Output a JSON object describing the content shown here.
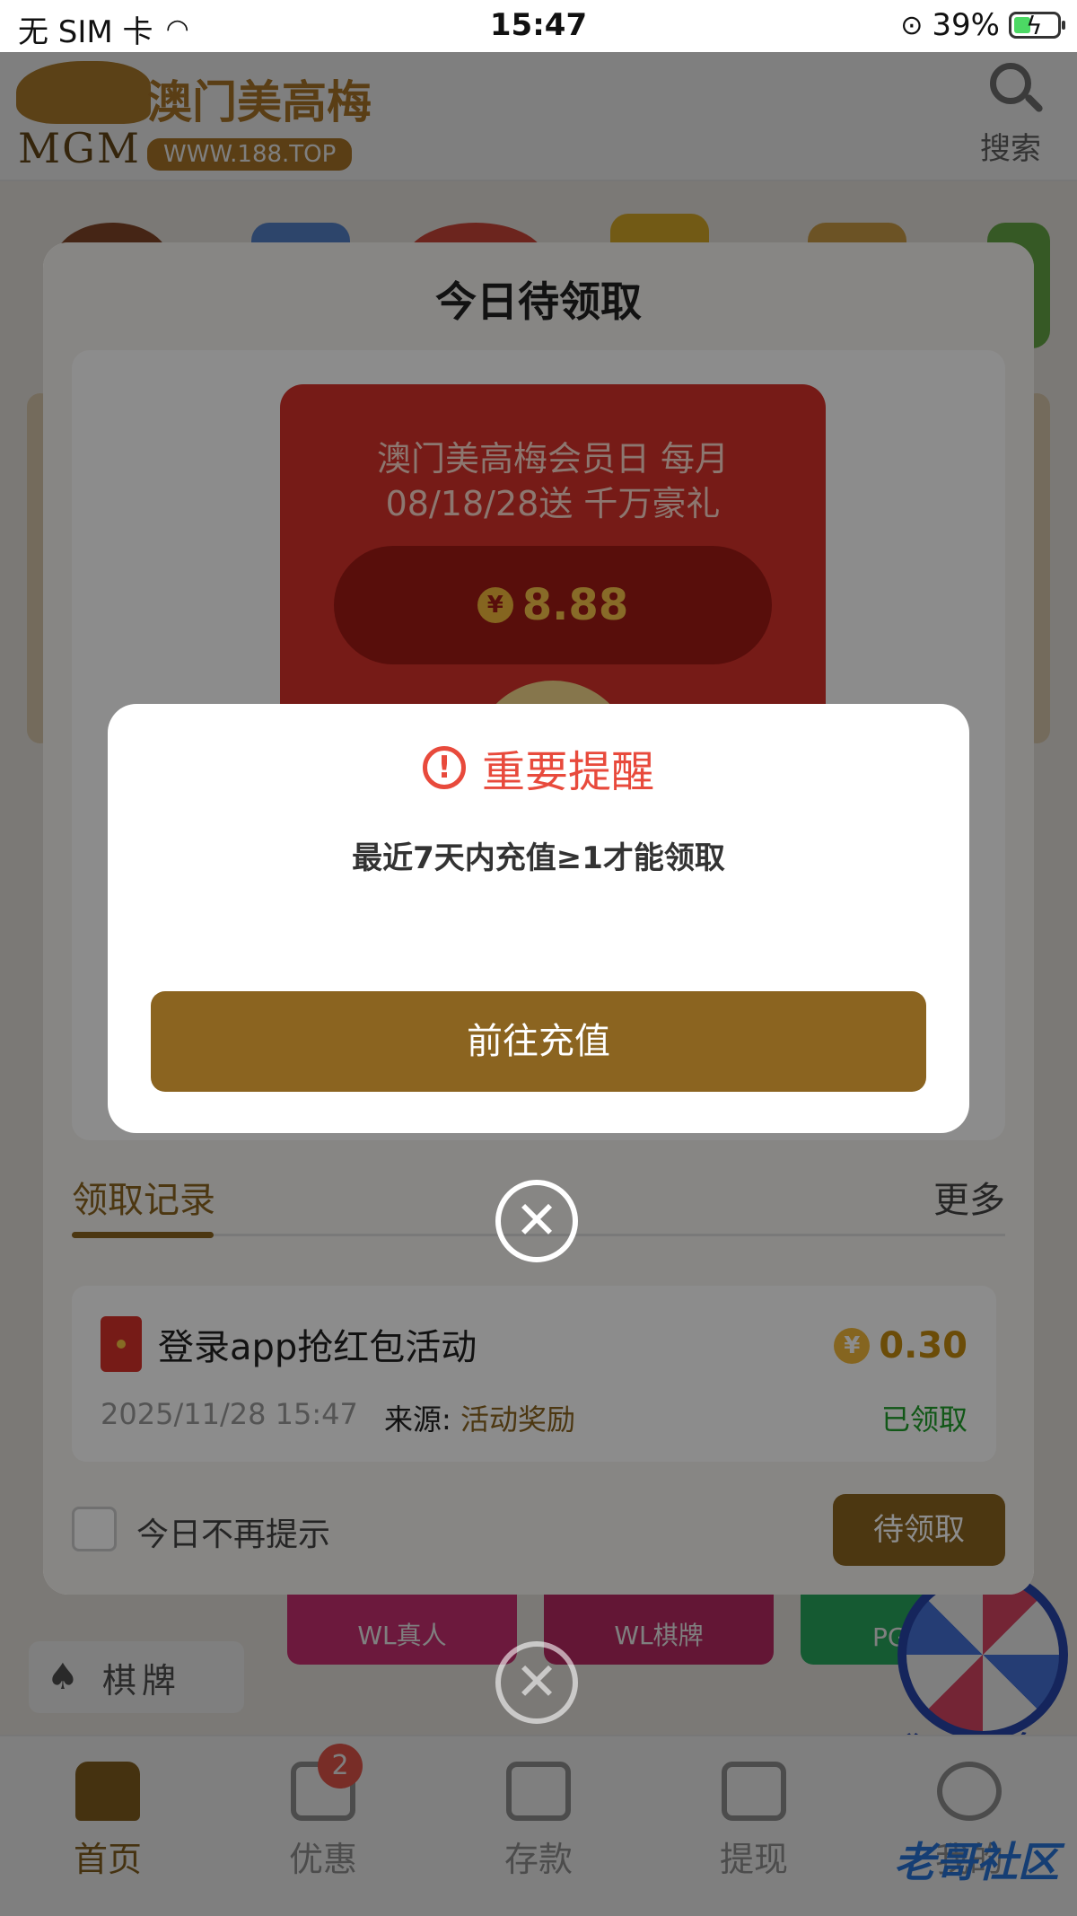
{
  "status_bar": {
    "carrier": "无 SIM 卡",
    "time": "15:47",
    "battery_percent": "39%"
  },
  "header": {
    "brand_cn": "澳门美高梅",
    "brand_en": "MGM",
    "site_url": "WWW.188.TOP",
    "search_label": "搜索"
  },
  "page": {
    "category_label": "棋牌",
    "tiles": [
      "WL真人",
      "WL棋牌",
      "PG"
    ],
    "wheel_label": "狂欢转盘"
  },
  "claim_panel": {
    "title": "今日待领取",
    "red_packet": {
      "line1": "澳门美高梅会员日 每月",
      "line2": "08/18/28送 千万豪礼",
      "amount": "8.88",
      "currency_symbol": "¥"
    },
    "records_tab": "领取记录",
    "more": "更多",
    "record": {
      "title": "登录app抢红包活动",
      "amount": "0.30",
      "currency_symbol": "¥",
      "date": "2025/11/28 15:47",
      "source_label": "来源:",
      "source_value": "活动奖励",
      "status": "已领取"
    },
    "dont_remind": "今日不再提示",
    "pending_button": "待领取"
  },
  "alert": {
    "title": "重要提醒",
    "message": "最近7天内充值≥1才能领取",
    "button": "前往充值"
  },
  "tabbar": {
    "items": [
      {
        "label": "首页",
        "icon": "home-icon",
        "active": true
      },
      {
        "label": "优惠",
        "icon": "gift-icon",
        "badge": "2"
      },
      {
        "label": "存款",
        "icon": "wallet-icon"
      },
      {
        "label": "提现",
        "icon": "ticket-icon"
      },
      {
        "label": "我的",
        "icon": "user-icon"
      }
    ]
  },
  "watermark": "老哥社区",
  "colors": {
    "accent": "#8b6420",
    "alert_red": "#e84a3c",
    "claimed_green": "#1f9e2b",
    "packet_red": "#d7322b"
  }
}
